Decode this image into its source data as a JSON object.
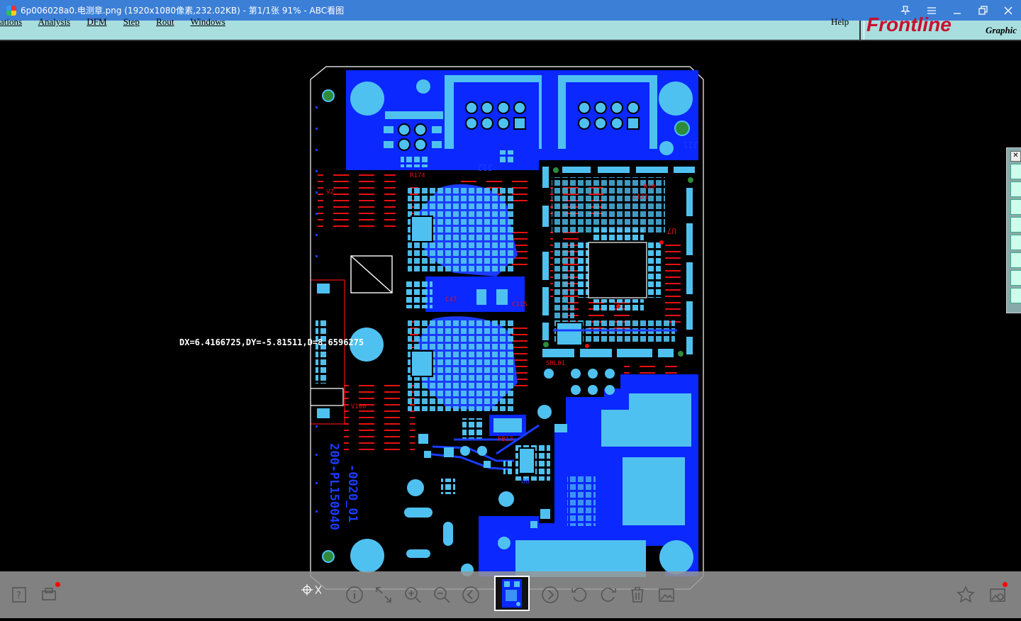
{
  "window": {
    "title": "6p006028a0.电测章.png (1920x1080像素,232.02KB) - 第1/1张 91% - ABC看图",
    "controls": [
      "pin-icon",
      "menu-icon",
      "minimize-icon",
      "restore-icon",
      "close-icon"
    ]
  },
  "app_strip": {
    "menus": [
      "ations",
      "Analysis",
      "DFM",
      "Step",
      "Rout",
      "Windows"
    ],
    "help": "Help",
    "logo": "Frontline",
    "graphic": "Graphic"
  },
  "board": {
    "measurement": "DX=6.4166725,DY=-5.81511,D=8.6596275",
    "silk_vertical_1": "200-PL150040",
    "silk_vertical_2": "-0020_01",
    "refs": {
      "J12": "J12",
      "J11": "J11",
      "U7": "U7",
      "U6": "U6",
      "FB13": "FB13",
      "SHL01": "SHL01",
      "R174": "R174",
      "R19": "R19",
      "C131": "C131",
      "C115": "C115",
      "C47": "C47",
      "V2": "V2",
      "V100": "V100"
    },
    "colors": {
      "copper_top": "#0a28ff",
      "pad": "#4fc1f0",
      "silk_ref": "#ff1a1a",
      "outline": "#ffffff",
      "background": "#000000"
    }
  },
  "side_toolbar": {
    "items": 8
  },
  "bottom_bar": {
    "left_icons": [
      "help-icon",
      "print-icon"
    ],
    "center_icons": [
      "crop-icon",
      "info-icon",
      "fit-icon",
      "zoom-in-icon",
      "zoom-out-icon",
      "prev-icon",
      "next-icon",
      "rotate-left-icon",
      "rotate-right-icon",
      "delete-icon",
      "edit-icon"
    ],
    "right_icons": [
      "favorite-icon",
      "image-settings-icon"
    ],
    "thumbnail": "current-image-thumbnail"
  }
}
